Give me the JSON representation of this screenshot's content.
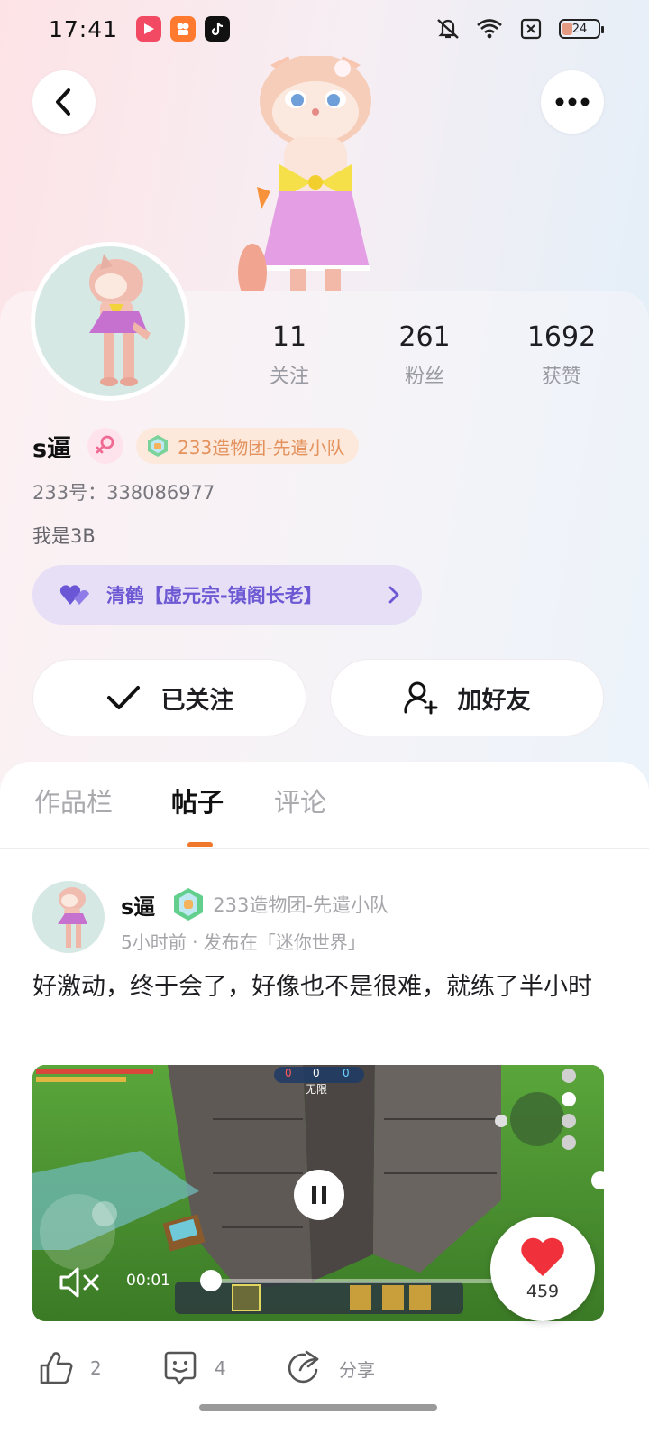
{
  "status_bar": {
    "time": "17:41",
    "battery": "24",
    "app_icons": [
      "video-app-icon",
      "kuaishou-app-icon",
      "tiktok-app-icon"
    ],
    "system_icons": [
      "mute-icon",
      "wifi-icon",
      "no-sim-icon",
      "battery-icon"
    ]
  },
  "header": {
    "back_icon": "chevron-left-icon",
    "more_icon": "more-dots-icon"
  },
  "profile": {
    "name": "s逼",
    "gender": "female",
    "guild": "233造物团-先遣小队",
    "id_line": "233号：338086977",
    "bio": "我是3B",
    "title_badge": "清鹤【虚元宗-镇阁长老】",
    "stats": [
      {
        "value": "11",
        "label": "关注"
      },
      {
        "value": "261",
        "label": "粉丝"
      },
      {
        "value": "1692",
        "label": "获赞"
      }
    ],
    "follow_button": "已关注",
    "add_friend_button": "加好友"
  },
  "tabs": [
    {
      "label": "作品栏",
      "active": false
    },
    {
      "label": "帖子",
      "active": true
    },
    {
      "label": "评论",
      "active": false
    }
  ],
  "post": {
    "author": "s逼",
    "guild": "233造物团-先遣小队",
    "meta": "5小时前 · 发布在「迷你世界」",
    "text": "好激动，终于会了，好像也不是很难，就练了半小时",
    "video": {
      "time": "00:01",
      "mode_label": "无限",
      "score": [
        "0",
        "0",
        "0"
      ],
      "progress": 0.0,
      "muted": true,
      "paused": true
    },
    "like_count": "459",
    "thumb_count": "2",
    "comment_count": "4",
    "share_label": "分享"
  },
  "colors": {
    "accent_orange": "#f0782d",
    "title_purple": "#6d58d4",
    "guild_orange": "#e3925d",
    "like_red": "#f0303a"
  }
}
